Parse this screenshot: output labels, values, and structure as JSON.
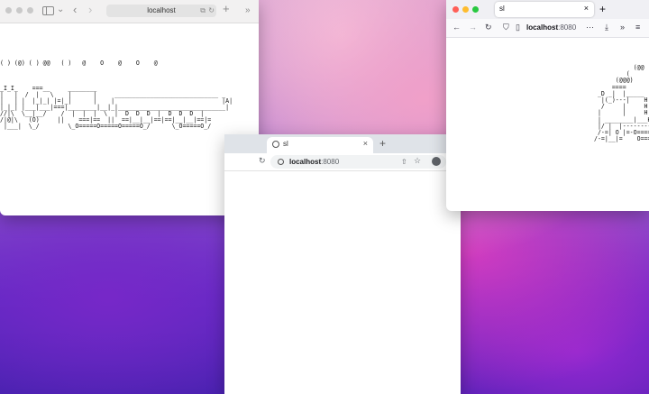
{
  "safari": {
    "address": "localhost",
    "ascii": "( ) (@) ( ) @@   ( )   @    O    @    O    @\n\n\n\n_I_I_    ===__     ________\n|   |  /  |   \\    |      |     _____________________________ _\n|   | |  |_|_| |=|_|      |    |                              |A|\n|_|_| |___|___|===|________|__|_|______________________________|\n//|\\  \\__|__/    /  |  |  |  \\  |  D  D  D  |  D  D  D  |\n/|@|\\   (O)     ||    ===|==  ||  ==|__|__|==|==|__|__|==|=\n |___|  \\_/        \\_O=====O=====O=====O_/      \\_O=====O_/"
  },
  "chrome": {
    "tab_title": "sl",
    "close_glyph": "×",
    "new_tab_glyph": "+",
    "reload_glyph": "↻",
    "share_glyph": "⇧",
    "star_glyph": "☆",
    "url_host": "localhost",
    "url_port": ":8080"
  },
  "firefox": {
    "tab_title": "sl",
    "close_glyph": "×",
    "new_tab_glyph": "+",
    "back_glyph": "←",
    "forward_glyph": "→",
    "reload_glyph": "↻",
    "shield_glyph": "⛉",
    "page_glyph": "▯",
    "more_glyph": "···",
    "download_glyph": "⤓",
    "overflow_glyph": "»",
    "menu_glyph": "≡",
    "url_host": "localhost",
    "url_port": ":8080",
    "ascii": "            (@@\n          (\n       (@@@)\n      ====\n  _D _|  |_____\n   |(_)---|    H\n   /     |     H\n  |      |     H\n  | ________|___H__/\n  |/ |  |-----------I\n  /-=| O |=-O=====O=\n /-=|__|=    O=====O"
  },
  "safari_icons": {
    "back_glyph": "‹",
    "forward_glyph": "›",
    "chevron_glyph": "⌄",
    "translate_glyph": "⧉",
    "reload_glyph": "↻",
    "new_tab_glyph": "+",
    "overflow_glyph": "»"
  }
}
